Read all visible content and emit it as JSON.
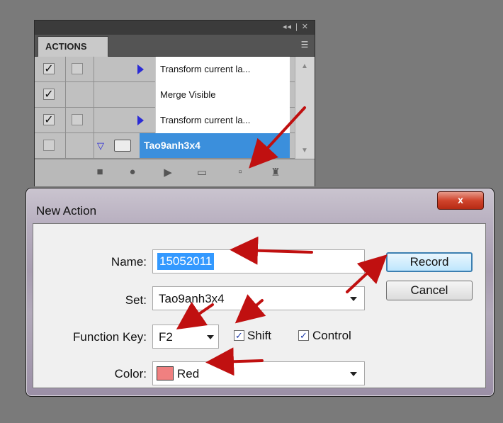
{
  "actions_panel": {
    "tab_label": "ACTIONS",
    "header_controls": "◂◂ | ✕",
    "menu_icon": "menu-icon",
    "rows": [
      {
        "checked": true,
        "has_dialog_box": true,
        "expandable": true,
        "label": "Transform current la..."
      },
      {
        "checked": true,
        "has_dialog_box": false,
        "expandable": false,
        "label": "Merge Visible"
      },
      {
        "checked": true,
        "has_dialog_box": true,
        "expandable": true,
        "label": "Transform current la..."
      },
      {
        "checked": false,
        "has_dialog_box": true,
        "expandable": true,
        "is_set": true,
        "selected": true,
        "label": "Tao9anh3x4"
      }
    ],
    "footer_icons": [
      "stop-icon",
      "record-icon",
      "play-icon",
      "folder-icon",
      "new-action-icon",
      "trash-icon"
    ]
  },
  "dialog": {
    "title": "New Action",
    "close_label": "x",
    "name_label": "Name:",
    "name_value": "15052011",
    "set_label": "Set:",
    "set_value": "Tao9anh3x4",
    "function_key_label": "Function Key:",
    "function_key_value": "F2",
    "shift_label": "Shift",
    "shift_checked": true,
    "control_label": "Control",
    "control_checked": true,
    "color_label": "Color:",
    "color_value": "Red",
    "color_swatch": "#f08080",
    "record_label": "Record",
    "cancel_label": "Cancel"
  },
  "colors": {
    "annotation_arrow": "#c01010",
    "selection_blue": "#3399ff",
    "set_row_highlight": "#3b8fdc"
  }
}
